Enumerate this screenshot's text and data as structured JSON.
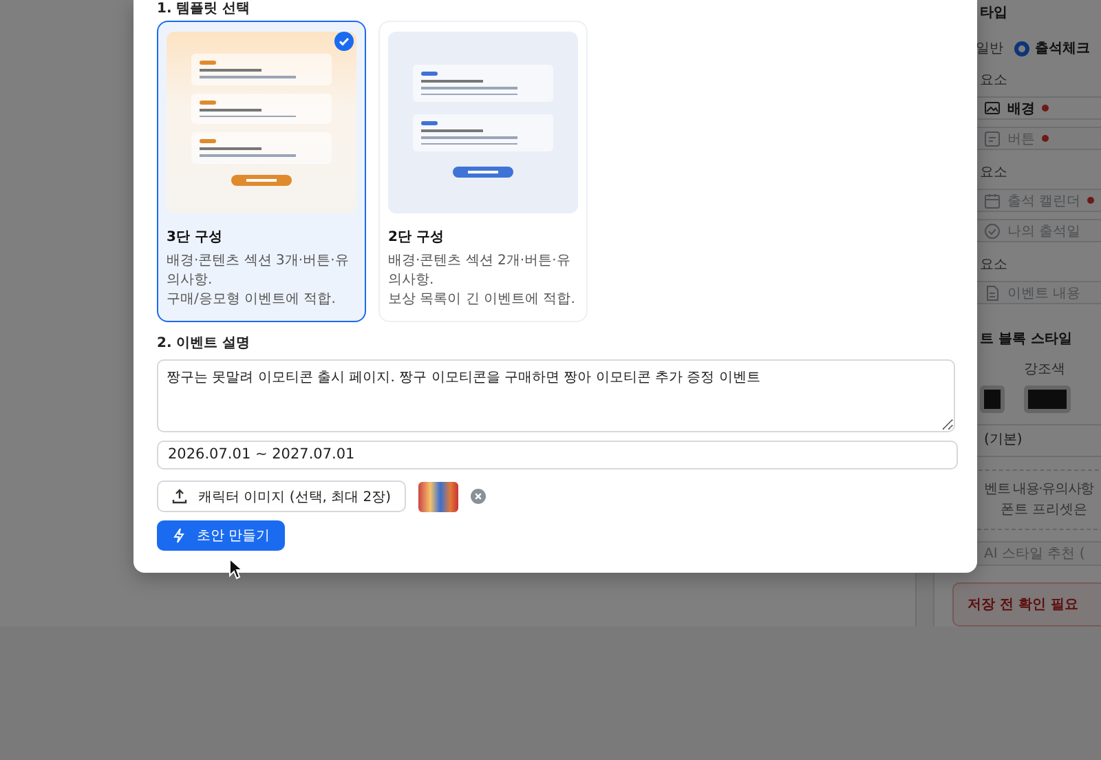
{
  "template_section": {
    "title": "1. 템플릿 선택",
    "templates": [
      {
        "kind": "three",
        "name": "3단 구성",
        "description_lines": [
          "배경·콘텐츠 섹션 3개·버튼·유의사항.",
          "구매/응모형 이벤트에 적합."
        ],
        "selected": true
      },
      {
        "kind": "two",
        "name": "2단 구성",
        "description_lines": [
          "배경·콘텐츠 섹션 2개·버튼·유의사항.",
          "보상 목록이 긴 이벤트에 적합."
        ],
        "selected": false
      }
    ]
  },
  "description_section": {
    "title": "2. 이벤트 설명",
    "description": "짱구는 못말려 이모티콘 출시 페이지. 짱구 이모티콘을 구매하면 짱아 이모티콘 추가 증정 이벤트",
    "period": "2026.07.01 ~ 2027.07.01",
    "upload_button": "캐릭터 이미지 (선택, 최대 2장)",
    "generate_button": "초안 만들기"
  },
  "side_panel": {
    "type_title": "타입",
    "type_options": [
      {
        "label": "일반",
        "selected": false
      },
      {
        "label": "출석체크",
        "selected": true
      }
    ],
    "groups": [
      {
        "label": "요소",
        "items": [
          {
            "label": "배경",
            "kind": "image",
            "required": true,
            "disabled": false
          },
          {
            "label": "버튼",
            "kind": "button",
            "required": true,
            "disabled": true
          }
        ]
      },
      {
        "label": "요소",
        "items": [
          {
            "label": "출석 캘린더",
            "kind": "calendar",
            "required": true,
            "disabled": true
          },
          {
            "label": "나의 출석일",
            "kind": "check",
            "required": false,
            "disabled": true
          }
        ]
      },
      {
        "label": "요소",
        "items": [
          {
            "label": "이벤트 내용",
            "kind": "doc",
            "required": false,
            "disabled": true
          }
        ]
      }
    ],
    "block_style_title": "트 블록 스타일",
    "accent_label": "강조색",
    "font_select": "(기본)",
    "note_lines": [
      "벤트 내용·유의사항",
      "폰트 프리셋은"
    ],
    "ai_button": "AI 스타일 추천 (",
    "warning_title": "저장 전 확인 필요"
  }
}
